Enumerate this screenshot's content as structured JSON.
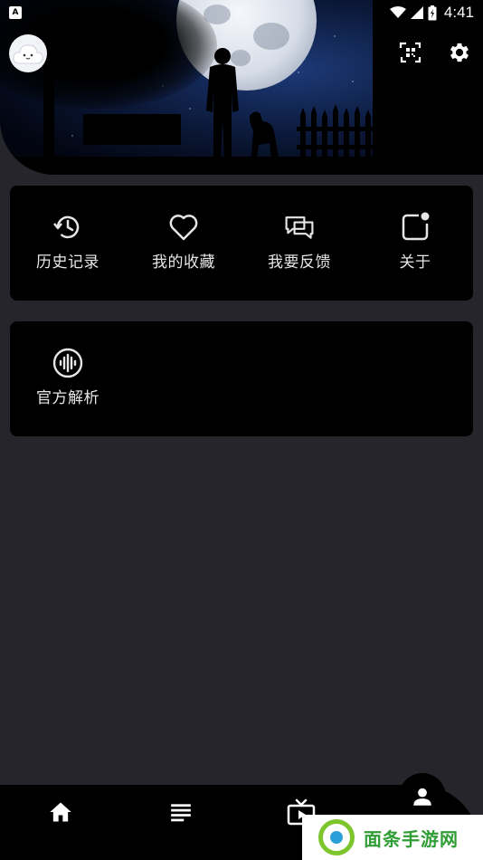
{
  "status_bar": {
    "time": "4:41",
    "sim_letter": "A"
  },
  "header": {
    "avatar_icon": "cloud-avatar-icon",
    "scan_icon": "qr-scan-icon",
    "settings_icon": "gear-icon"
  },
  "quick_actions": [
    {
      "label": "历史记录",
      "icon": "history-icon"
    },
    {
      "label": "我的收藏",
      "icon": "heart-icon"
    },
    {
      "label": "我要反馈",
      "icon": "chat-feedback-icon"
    },
    {
      "label": "关于",
      "icon": "about-notification-icon"
    }
  ],
  "tools": [
    {
      "label": "官方解析",
      "icon": "sound-wave-icon"
    }
  ],
  "bottom_nav": {
    "items": [
      "home-icon",
      "list-icon",
      "tv-play-icon",
      "profile-icon"
    ]
  },
  "watermark": {
    "text": "面条手游网"
  },
  "colors": {
    "background": "#26252b",
    "card": "#000000",
    "text": "#e6e6e6",
    "watermark_green": "#2f9e35"
  }
}
